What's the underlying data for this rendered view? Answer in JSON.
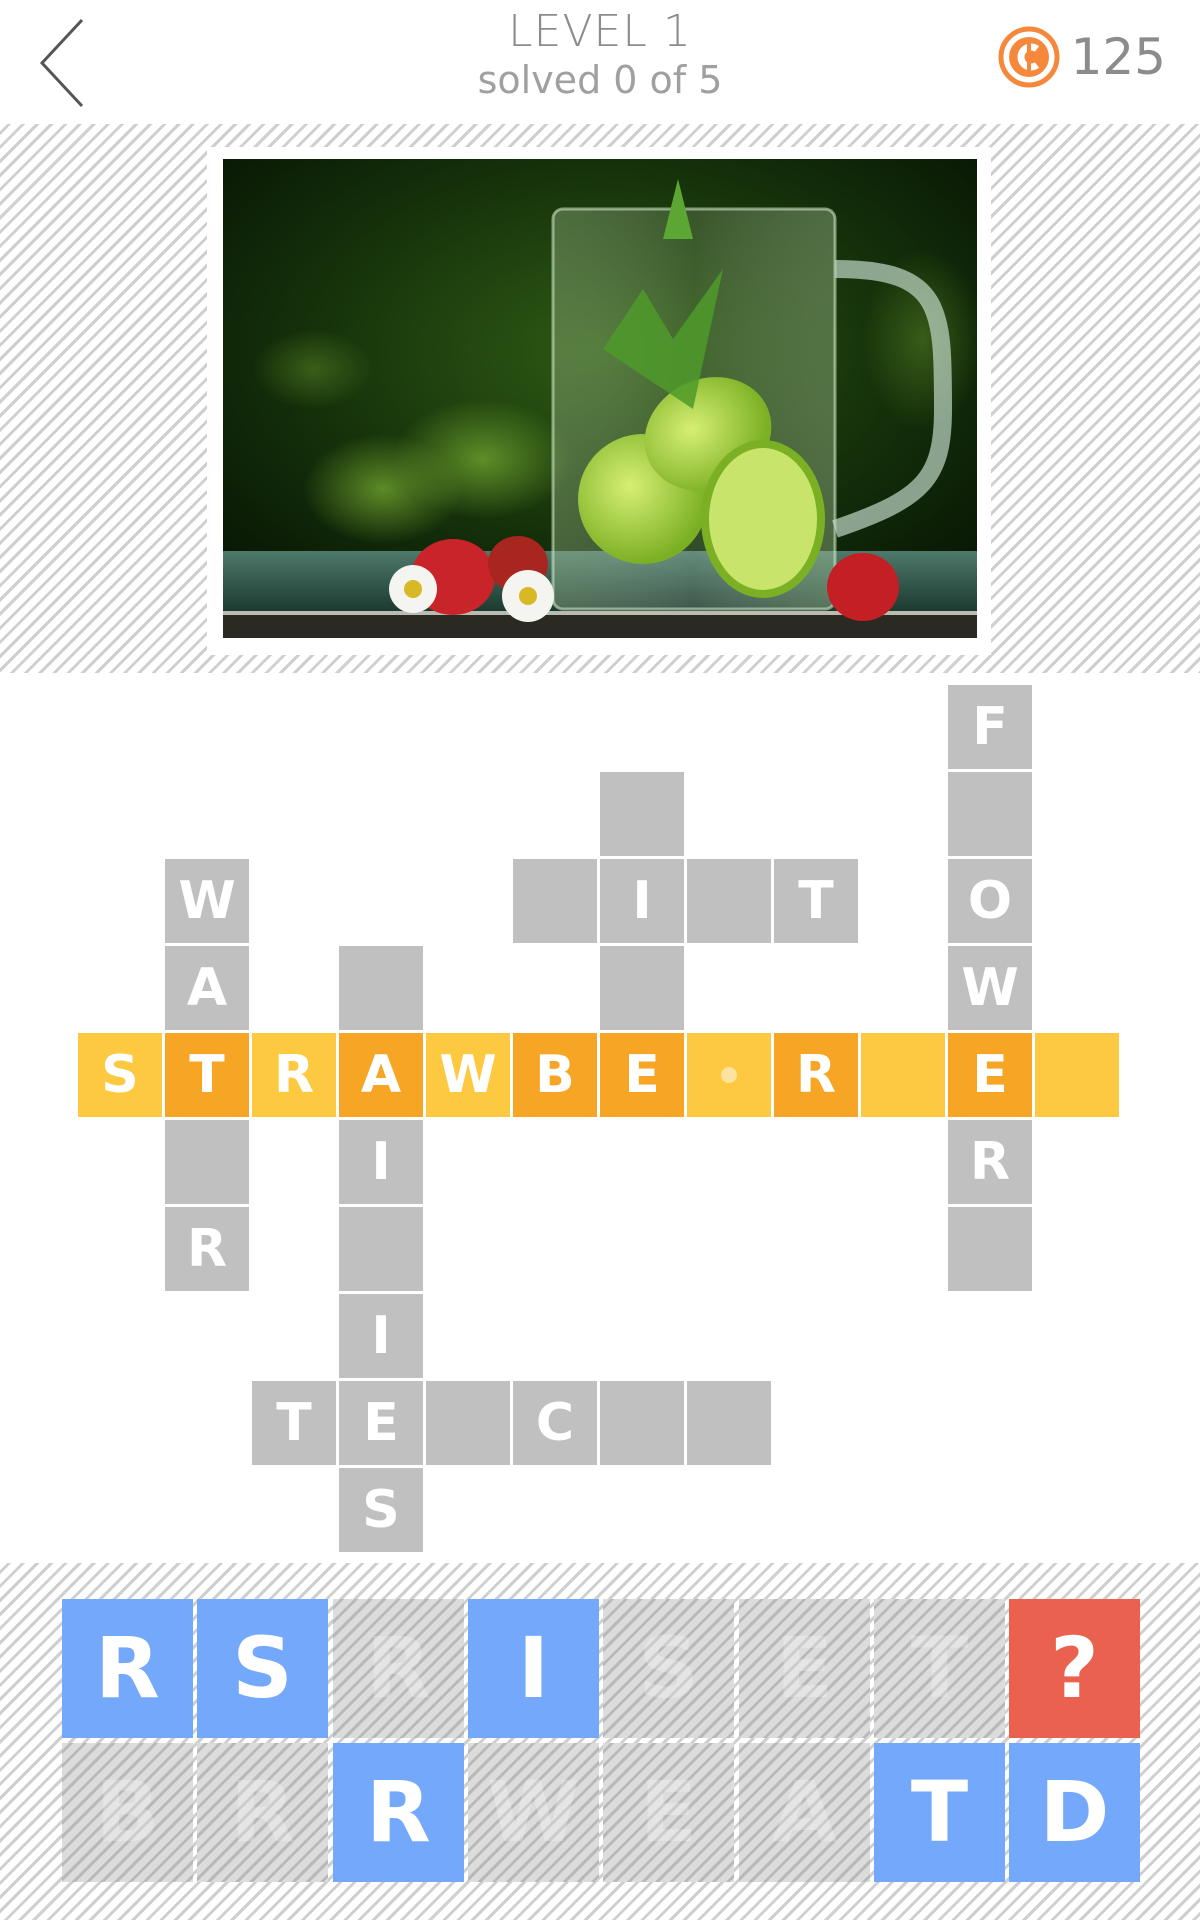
{
  "header": {
    "back_icon": "chevron-left-icon",
    "level_title": "LEVEL 1",
    "progress_text": "solved 0 of 5",
    "coin_icon": "coin-icon",
    "coins": "125",
    "coin_color": "#f5883a"
  },
  "photo": {
    "description": "glass mug of water with limes and mint, strawberries and daisies"
  },
  "colors": {
    "empty_cell": "#c0c0c0",
    "highlight_light": "#fdc940",
    "highlight_dark": "#f7a525",
    "key_available": "#73a8fb",
    "key_hint": "#ea6150"
  },
  "crossword": {
    "cells": [
      {
        "r": 0,
        "c": 10,
        "letter": "F"
      },
      {
        "r": 1,
        "c": 10,
        "letter": ""
      },
      {
        "r": 2,
        "c": 10,
        "letter": "O"
      },
      {
        "r": 3,
        "c": 10,
        "letter": "W"
      },
      {
        "r": 5,
        "c": 10,
        "letter": "R"
      },
      {
        "r": 6,
        "c": 10,
        "letter": ""
      },
      {
        "r": 1,
        "c": 6,
        "letter": ""
      },
      {
        "r": 2,
        "c": 6,
        "letter": "I"
      },
      {
        "r": 3,
        "c": 6,
        "letter": ""
      },
      {
        "r": 2,
        "c": 5,
        "letter": ""
      },
      {
        "r": 2,
        "c": 7,
        "letter": ""
      },
      {
        "r": 2,
        "c": 8,
        "letter": "T"
      },
      {
        "r": 2,
        "c": 1,
        "letter": "W"
      },
      {
        "r": 3,
        "c": 1,
        "letter": "A"
      },
      {
        "r": 5,
        "c": 1,
        "letter": ""
      },
      {
        "r": 6,
        "c": 1,
        "letter": "R"
      },
      {
        "r": 3,
        "c": 3,
        "letter": ""
      },
      {
        "r": 5,
        "c": 3,
        "letter": "I"
      },
      {
        "r": 6,
        "c": 3,
        "letter": ""
      },
      {
        "r": 7,
        "c": 3,
        "letter": "I"
      },
      {
        "r": 8,
        "c": 3,
        "letter": "E"
      },
      {
        "r": 9,
        "c": 3,
        "letter": "S"
      },
      {
        "r": 8,
        "c": 2,
        "letter": "T"
      },
      {
        "r": 8,
        "c": 4,
        "letter": ""
      },
      {
        "r": 8,
        "c": 5,
        "letter": "C"
      },
      {
        "r": 8,
        "c": 6,
        "letter": ""
      },
      {
        "r": 8,
        "c": 7,
        "letter": ""
      },
      {
        "r": 4,
        "c": 0,
        "letter": "S",
        "hl": "light"
      },
      {
        "r": 4,
        "c": 1,
        "letter": "T",
        "hl": "dark"
      },
      {
        "r": 4,
        "c": 2,
        "letter": "R",
        "hl": "light"
      },
      {
        "r": 4,
        "c": 3,
        "letter": "A",
        "hl": "dark"
      },
      {
        "r": 4,
        "c": 4,
        "letter": "W",
        "hl": "light"
      },
      {
        "r": 4,
        "c": 5,
        "letter": "B",
        "hl": "dark"
      },
      {
        "r": 4,
        "c": 6,
        "letter": "E",
        "hl": "dark"
      },
      {
        "r": 4,
        "c": 7,
        "letter": "",
        "hl": "light",
        "cursor": true
      },
      {
        "r": 4,
        "c": 8,
        "letter": "R",
        "hl": "dark"
      },
      {
        "r": 4,
        "c": 9,
        "letter": "",
        "hl": "light"
      },
      {
        "r": 4,
        "c": 10,
        "letter": "E",
        "hl": "dark"
      },
      {
        "r": 4,
        "c": 11,
        "letter": "",
        "hl": "light"
      }
    ]
  },
  "keyboard": {
    "rows": [
      [
        {
          "letter": "R",
          "state": "available"
        },
        {
          "letter": "S",
          "state": "available"
        },
        {
          "letter": "R",
          "state": "used"
        },
        {
          "letter": "I",
          "state": "available"
        },
        {
          "letter": "S",
          "state": "used"
        },
        {
          "letter": "E",
          "state": "used"
        },
        {
          "letter": "T",
          "state": "used"
        },
        {
          "letter": "?",
          "state": "hint"
        }
      ],
      [
        {
          "letter": "B",
          "state": "used"
        },
        {
          "letter": "R",
          "state": "used"
        },
        {
          "letter": "R",
          "state": "available"
        },
        {
          "letter": "W",
          "state": "used"
        },
        {
          "letter": "E",
          "state": "used"
        },
        {
          "letter": "A",
          "state": "used"
        },
        {
          "letter": "T",
          "state": "available"
        },
        {
          "letter": "D",
          "state": "available"
        }
      ]
    ]
  }
}
